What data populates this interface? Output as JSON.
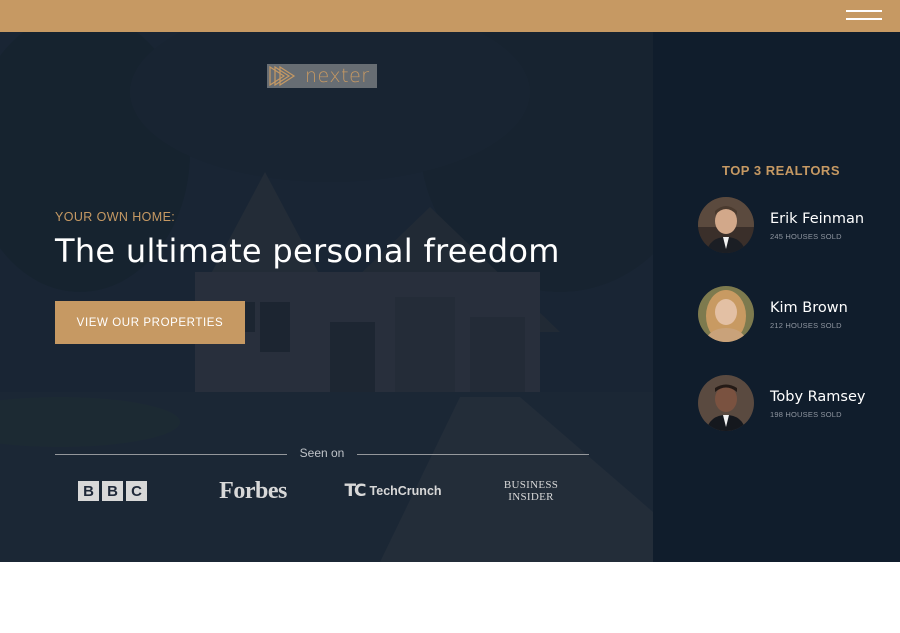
{
  "header": {
    "background": "#c69963",
    "menu_icon": "hamburger-menu-icon"
  },
  "hero": {
    "logo_text": "nexter",
    "logo_icon": "play-triangles-icon",
    "eyebrow": "YOUR OWN HOME:",
    "headline": "The ultimate personal freedom",
    "cta_label": "VIEW OUR PROPERTIES",
    "seen_on_label": "Seen on",
    "press": {
      "bbc": [
        "B",
        "B",
        "C"
      ],
      "forbes": "Forbes",
      "techcrunch_mark": "TC",
      "techcrunch": "TechCrunch",
      "business_insider_line1": "BUSINESS",
      "business_insider_line2": "INSIDER"
    }
  },
  "realtors": {
    "title": "TOP 3 REALTORS",
    "items": [
      {
        "name": "Erik Feinman",
        "sold": "245 HOUSES SOLD"
      },
      {
        "name": "Kim Brown",
        "sold": "212 HOUSES SOLD"
      },
      {
        "name": "Toby Ramsey",
        "sold": "198 HOUSES SOLD"
      }
    ]
  },
  "colors": {
    "accent": "#c69963",
    "dark_navy": "#101d2c",
    "white": "#ffffff"
  }
}
